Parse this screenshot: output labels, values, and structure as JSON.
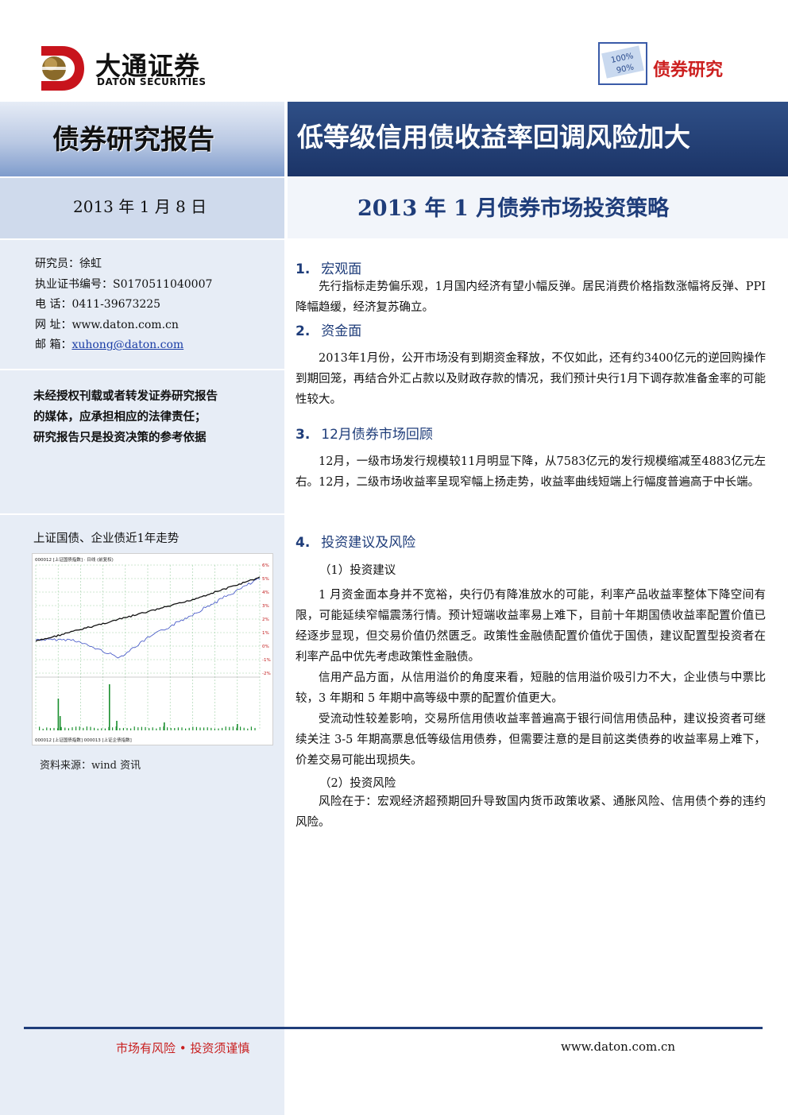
{
  "header": {
    "logo_cn": "大通证券",
    "logo_en": "DATON SECURITIES",
    "badge_label": "债券研究",
    "badge_stamp_lines": [
      "100%",
      "90%"
    ]
  },
  "title": {
    "left": "债券研究报告",
    "right": "低等级信用债收益率回调风险加大"
  },
  "subtitle": {
    "date": "2013 年 1 月 8 日",
    "strategy": "2013 年 1 月债券市场投资策略"
  },
  "contact": {
    "analyst": "研究员：徐虹",
    "license": "执业证书编号：S0170511040007",
    "phone": "电    话：0411-39673225",
    "website": "网    址：www.daton.com.cn",
    "email_label": "邮    箱：",
    "email": "xuhong@daton.com"
  },
  "warning": {
    "line1": "未经授权刊载或者转发证券研究报告",
    "line2": "的媒体，应承担相应的法律责任；",
    "line3": "研究报告只是投资决策的参考依据"
  },
  "chart": {
    "title": "上证国债、企业债近1年走势",
    "source": "资料来源：wind 资讯",
    "top_label": "000012 [上证国债指数] · 日线 (前复权)",
    "bottom_label": "000012 [上证国债指数]  000013 [上证企债指数]",
    "right_ticks": [
      "6%",
      "5%",
      "4%",
      "3%",
      "2%",
      "1%",
      "0%",
      "-1%",
      "-2%"
    ],
    "colors": {
      "series1": "#111111",
      "series2": "#3b4fc4",
      "volume": "#1a8f2e",
      "grid": "#9fd0a6"
    }
  },
  "sections": {
    "s1": {
      "num": "1.",
      "title": "宏观面",
      "para": "先行指标走势偏乐观，1月国内经济有望小幅反弹。居民消费价格指数涨幅将反弹、PPI降幅趋缓，经济复苏确立。"
    },
    "s2": {
      "num": "2.",
      "title": "资金面",
      "para": "2013年1月份，公开市场没有到期资金释放，不仅如此，还有约3400亿元的逆回购操作到期回笼，再结合外汇占款以及财政存款的情况，我们预计央行1月下调存款准备金率的可能性较大。"
    },
    "s3": {
      "num": "3.",
      "title": "12月债券市场回顾",
      "para": "12月，一级市场发行规模较11月明显下降，从7583亿元的发行规模缩减至4883亿元左右。12月，二级市场收益率呈现窄幅上扬走势，收益率曲线短端上行幅度普遍高于中长端。"
    },
    "s4": {
      "num": "4.",
      "title": "投资建议及风险",
      "sub1": "（1）投资建议",
      "p1": "1 月资金面本身并不宽裕，央行仍有降准放水的可能，利率产品收益率整体下降空间有限，可能延续窄幅震荡行情。预计短端收益率易上难下，目前十年期国债收益率配置价值已经逐步显现，但交易价值仍然匮乏。政策性金融债配置价值优于国债，建议配置型投资者在利率产品中优先考虑政策性金融债。",
      "p2": "信用产品方面，从信用溢价的角度来看，短融的信用溢价吸引力不大，企业债与中票比较，3 年期和 5 年期中高等级中票的配置价值更大。",
      "p3": "受流动性较差影响，交易所信用债收益率普遍高于银行间信用债品种，建议投资者可继续关注 3-5 年期高票息低等级信用债券，但需要注意的是目前这类债券的收益率易上难下，价差交易可能出现损失。",
      "sub2": "（2）投资风险",
      "p4": "风险在于：宏观经济超预期回升导致国内货币政策收紧、通胀风险、信用债个券的违约风险。"
    }
  },
  "footer": {
    "left": "市场有风险 • 投资须谨慎",
    "right": "www.daton.com.cn"
  }
}
